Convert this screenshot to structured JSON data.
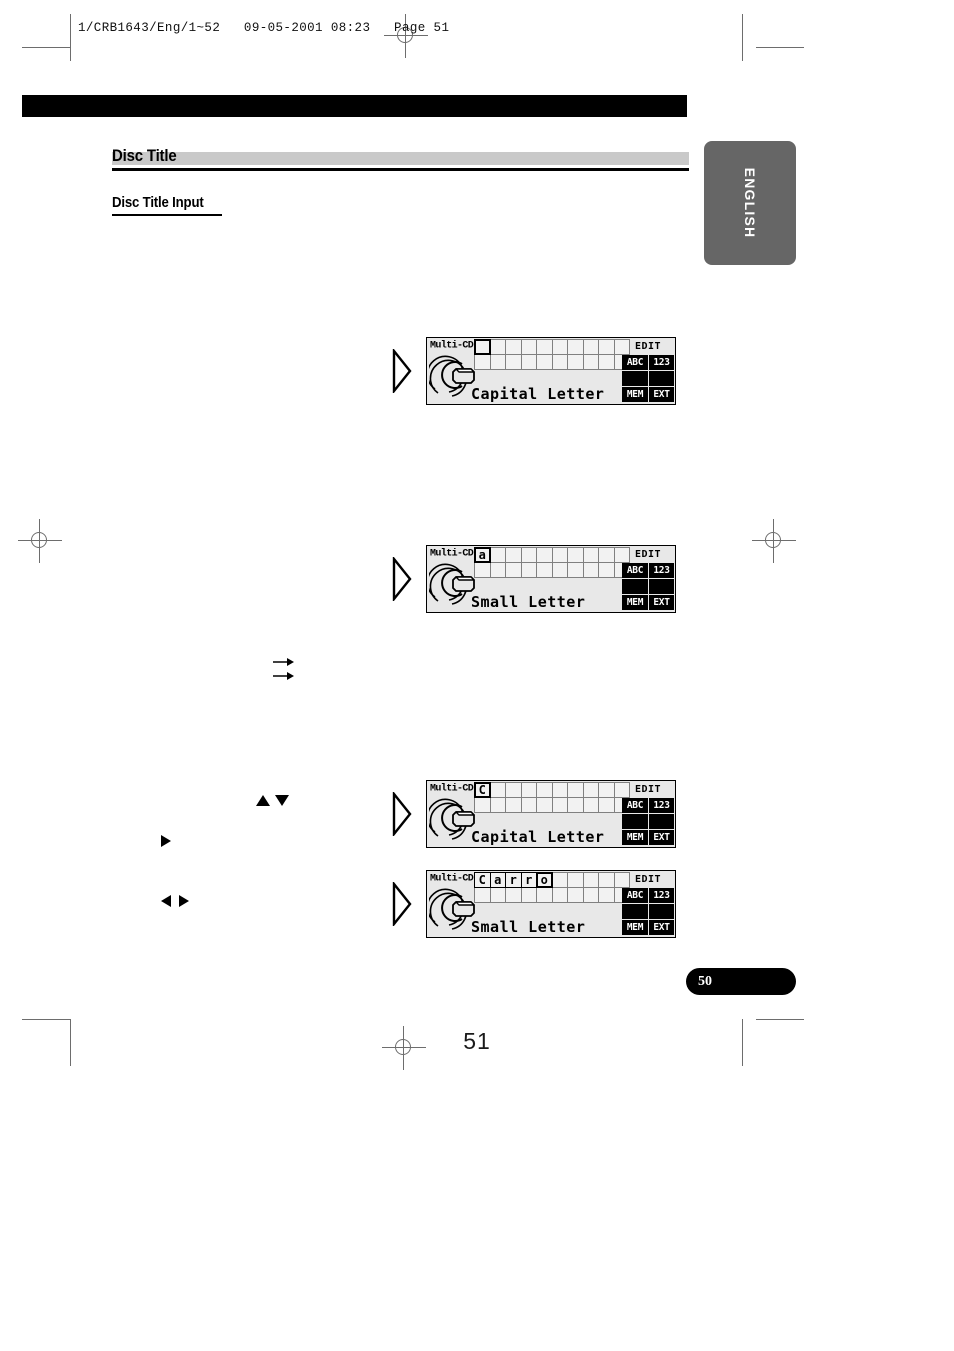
{
  "document": {
    "slug": "1/CRB1643/Eng/1~52   09-05-2001 08:23   Page 51",
    "folio": "51",
    "page_tab": "50",
    "language_tab": "ENGLISH"
  },
  "section": {
    "heading": "Disc Title",
    "subheading": "Disc Title Input"
  },
  "figures": [
    {
      "source_label": "Multi-CD",
      "title": "Capital Letter",
      "cells": [
        "",
        "",
        "",
        "",
        "",
        "",
        "",
        "",
        "",
        ""
      ],
      "cursor_index": 0,
      "cursor_empty": true,
      "indicators": {
        "edit": "EDIT",
        "row1": [
          "ABC",
          "123"
        ],
        "row2": [
          "",
          ""
        ],
        "row3": [
          "MEM",
          "EXT"
        ]
      }
    },
    {
      "source_label": "Multi-CD",
      "title": "Small Letter",
      "cells": [
        "a",
        "",
        "",
        "",
        "",
        "",
        "",
        "",
        "",
        ""
      ],
      "cursor_index": 0,
      "cursor_empty": false,
      "indicators": {
        "edit": "EDIT",
        "row1": [
          "ABC",
          "123"
        ],
        "row2": [
          "",
          ""
        ],
        "row3": [
          "MEM",
          "EXT"
        ]
      }
    },
    {
      "source_label": "Multi-CD",
      "title": "Capital Letter",
      "cells": [
        "C",
        "",
        "",
        "",
        "",
        "",
        "",
        "",
        "",
        ""
      ],
      "cursor_index": 0,
      "cursor_empty": false,
      "indicators": {
        "edit": "EDIT",
        "row1": [
          "ABC",
          "123"
        ],
        "row2": [
          "",
          ""
        ],
        "row3": [
          "MEM",
          "EXT"
        ]
      }
    },
    {
      "source_label": "Multi-CD",
      "title": "Small Letter",
      "cells": [
        "C",
        "a",
        "r",
        "r",
        "o",
        "",
        "",
        "",
        "",
        ""
      ],
      "cursor_index": 4,
      "cursor_empty": false,
      "indicators": {
        "edit": "EDIT",
        "row1": [
          "ABC",
          "123"
        ],
        "row2": [
          "",
          ""
        ],
        "row3": [
          "MEM",
          "EXT"
        ]
      }
    }
  ]
}
